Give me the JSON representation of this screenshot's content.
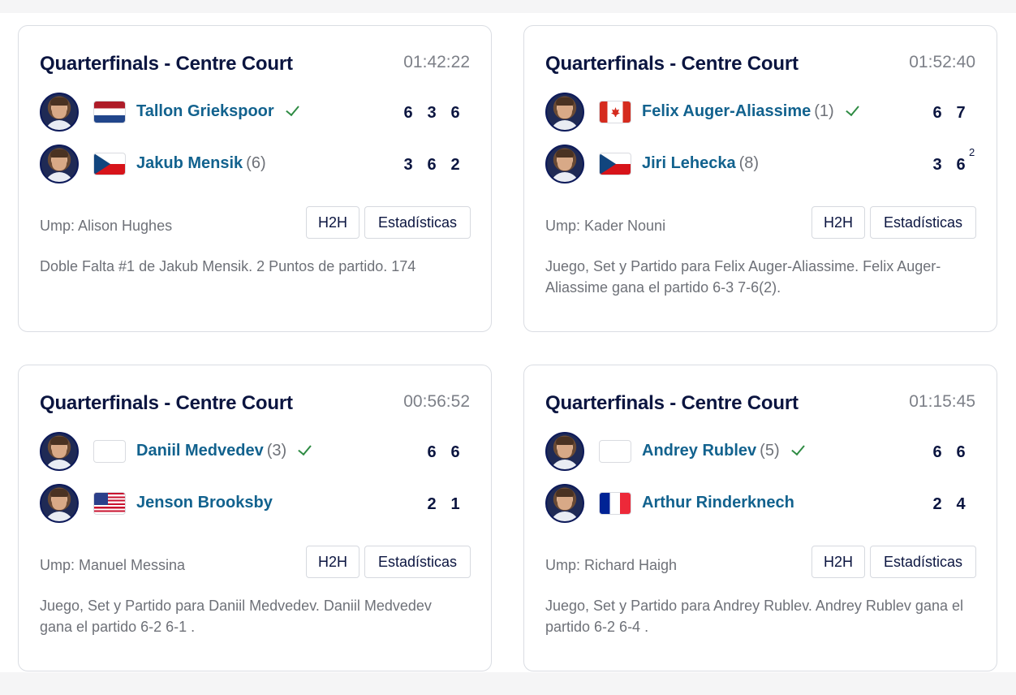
{
  "matches": [
    {
      "title": "Quarterfinals - Centre Court",
      "time": "01:42:22",
      "players": [
        {
          "name": "Tallon Griekspoor",
          "seed": "",
          "flag": "nl",
          "winner": true,
          "sets": [
            "6",
            "3",
            "6"
          ],
          "tb": [
            "",
            "",
            ""
          ]
        },
        {
          "name": "Jakub Mensik",
          "seed": "(6)",
          "flag": "cz",
          "winner": false,
          "sets": [
            "3",
            "6",
            "2"
          ],
          "tb": [
            "",
            "",
            ""
          ]
        }
      ],
      "umpire": "Ump: Alison Hughes",
      "h2h_label": "H2H",
      "stats_label": "Estadísticas",
      "description": "Doble Falta #1 de Jakub Mensik. 2 Puntos de partido. 174"
    },
    {
      "title": "Quarterfinals - Centre Court",
      "time": "01:52:40",
      "players": [
        {
          "name": "Felix Auger-Aliassime",
          "seed": "(1)",
          "flag": "ca",
          "winner": true,
          "sets": [
            "6",
            "7"
          ],
          "tb": [
            "",
            ""
          ]
        },
        {
          "name": "Jiri Lehecka",
          "seed": "(8)",
          "flag": "cz",
          "winner": false,
          "sets": [
            "3",
            "6"
          ],
          "tb": [
            "",
            "2"
          ]
        }
      ],
      "umpire": "Ump: Kader Nouni",
      "h2h_label": "H2H",
      "stats_label": "Estadísticas",
      "description": "Juego, Set y Partido para Felix Auger-Aliassime. Felix Auger-Aliassime gana el partido 6-3 7-6(2)."
    },
    {
      "title": "Quarterfinals - Centre Court",
      "time": "00:56:52",
      "players": [
        {
          "name": "Daniil Medvedev",
          "seed": "(3)",
          "flag": "blank",
          "winner": true,
          "sets": [
            "6",
            "6"
          ],
          "tb": [
            "",
            ""
          ]
        },
        {
          "name": "Jenson Brooksby",
          "seed": "",
          "flag": "us",
          "winner": false,
          "sets": [
            "2",
            "1"
          ],
          "tb": [
            "",
            ""
          ]
        }
      ],
      "umpire": "Ump: Manuel Messina",
      "h2h_label": "H2H",
      "stats_label": "Estadísticas",
      "description": "Juego, Set y Partido para Daniil Medvedev. Daniil Medvedev gana el partido 6-2 6-1 ."
    },
    {
      "title": "Quarterfinals - Centre Court",
      "time": "01:15:45",
      "players": [
        {
          "name": "Andrey Rublev",
          "seed": "(5)",
          "flag": "blank",
          "winner": true,
          "sets": [
            "6",
            "6"
          ],
          "tb": [
            "",
            ""
          ]
        },
        {
          "name": "Arthur Rinderknech",
          "seed": "",
          "flag": "fr",
          "winner": false,
          "sets": [
            "2",
            "4"
          ],
          "tb": [
            "",
            ""
          ]
        }
      ],
      "umpire": "Ump: Richard Haigh",
      "h2h_label": "H2H",
      "stats_label": "Estadísticas",
      "description": "Juego, Set y Partido para Andrey Rublev. Andrey Rublev gana el partido 6-2 6-4 ."
    }
  ],
  "colors": {
    "title": "#0b1540",
    "player_name": "#12628e",
    "winner_check": "#2e8b43",
    "muted_text": "#6e7178"
  }
}
